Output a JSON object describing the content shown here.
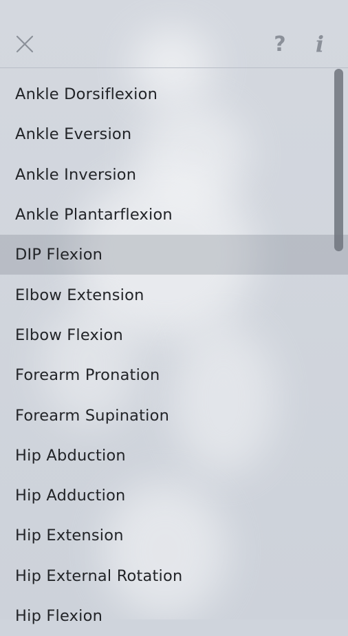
{
  "header": {
    "close_icon": "close-icon",
    "help_glyph": "?",
    "info_glyph": "i"
  },
  "list": {
    "selected_index": 4,
    "items": [
      "Ankle Dorsiflexion",
      "Ankle Eversion",
      "Ankle Inversion",
      "Ankle Plantarflexion",
      "DIP Flexion",
      "Elbow Extension",
      "Elbow Flexion",
      "Forearm Pronation",
      "Forearm Supination",
      "Hip Abduction",
      "Hip Adduction",
      "Hip Extension",
      "Hip External Rotation",
      "Hip Flexion"
    ]
  },
  "colors": {
    "background": "#cfd4dc",
    "icon": "#8b9099",
    "selected_row": "#b3b8c1",
    "scrollbar": "#6f747c"
  }
}
